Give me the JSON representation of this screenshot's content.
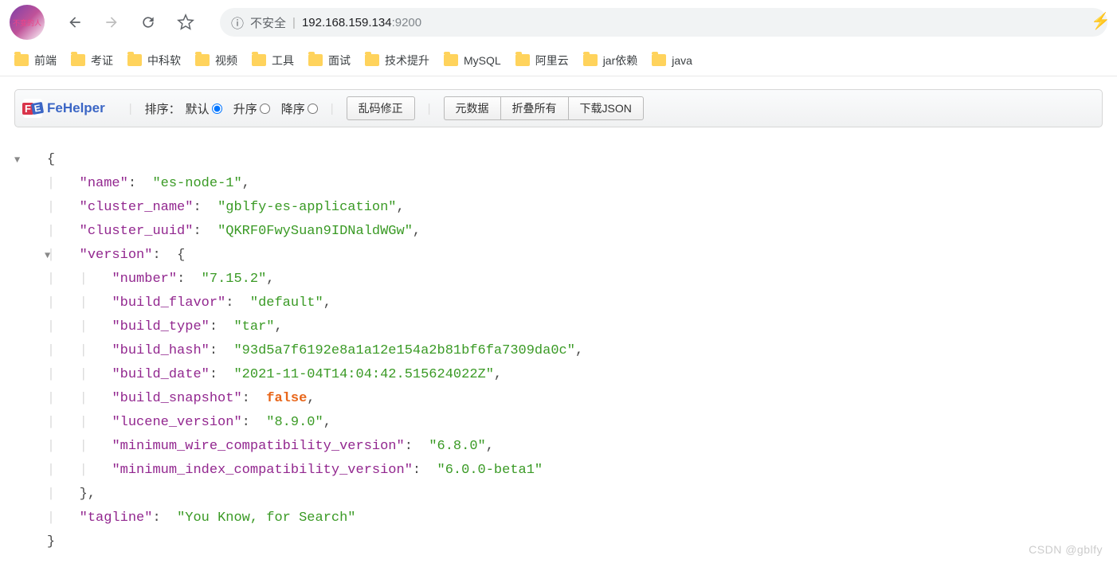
{
  "browser": {
    "insecure_label": "不安全",
    "url_host": "192.168.159.134",
    "url_port": ":9200"
  },
  "bookmarks": [
    "前端",
    "考证",
    "中科软",
    "视频",
    "工具",
    "面试",
    "技术提升",
    "MySQL",
    "阿里云",
    "jar依赖",
    "java"
  ],
  "toolbar": {
    "brand": "FeHelper",
    "sort_label": "排序：",
    "sort_default": "默认",
    "sort_asc": "升序",
    "sort_desc": "降序",
    "fix_encoding": "乱码修正",
    "metadata": "元数据",
    "collapse_all": "折叠所有",
    "download_json": "下载JSON"
  },
  "json": {
    "name_key": "\"name\"",
    "name_val": "\"es-node-1\"",
    "cluster_name_key": "\"cluster_name\"",
    "cluster_name_val": "\"gblfy-es-application\"",
    "cluster_uuid_key": "\"cluster_uuid\"",
    "cluster_uuid_val": "\"QKRF0FwySuan9IDNaldWGw\"",
    "version_key": "\"version\"",
    "number_key": "\"number\"",
    "number_val": "\"7.15.2\"",
    "build_flavor_key": "\"build_flavor\"",
    "build_flavor_val": "\"default\"",
    "build_type_key": "\"build_type\"",
    "build_type_val": "\"tar\"",
    "build_hash_key": "\"build_hash\"",
    "build_hash_val": "\"93d5a7f6192e8a1a12e154a2b81bf6fa7309da0c\"",
    "build_date_key": "\"build_date\"",
    "build_date_val": "\"2021-11-04T14:04:42.515624022Z\"",
    "build_snapshot_key": "\"build_snapshot\"",
    "build_snapshot_val": "false",
    "lucene_version_key": "\"lucene_version\"",
    "lucene_version_val": "\"8.9.0\"",
    "min_wire_key": "\"minimum_wire_compatibility_version\"",
    "min_wire_val": "\"6.8.0\"",
    "min_index_key": "\"minimum_index_compatibility_version\"",
    "min_index_val": "\"6.0.0-beta1\"",
    "tagline_key": "\"tagline\"",
    "tagline_val": "\"You Know, for Search\""
  },
  "watermark": "CSDN @gblfy"
}
